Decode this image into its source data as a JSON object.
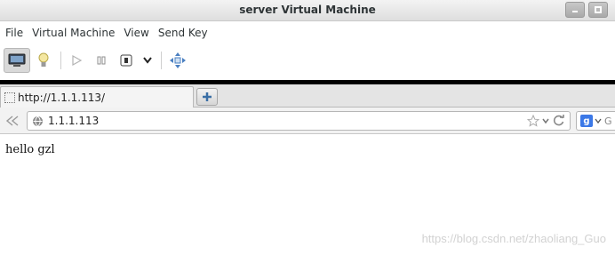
{
  "window": {
    "title": "server Virtual Machine"
  },
  "menubar": {
    "items": [
      "File",
      "Virtual Machine",
      "View",
      "Send Key"
    ]
  },
  "toolbar": {
    "buttons": [
      {
        "name": "console-icon",
        "active": true
      },
      {
        "name": "lightbulb-icon",
        "active": false
      },
      {
        "name": "play-icon",
        "active": false
      },
      {
        "name": "pause-icon",
        "active": false
      },
      {
        "name": "shutdown-icon",
        "active": false
      },
      {
        "name": "chevron-down-icon",
        "active": false
      },
      {
        "name": "fullscreen-move-icon",
        "active": false
      }
    ]
  },
  "browser": {
    "tab": {
      "title": "http://1.1.1.113/"
    },
    "urlbar": {
      "value": "1.1.1.113"
    },
    "search": {
      "placeholder": "G"
    }
  },
  "page": {
    "body_text": "hello gzl",
    "watermark": "https://blog.csdn.net/zhaoliang_Guo"
  },
  "colors": {
    "guest_border": "#000000",
    "g_logo": "#3b78e7",
    "chrome_gray": "#e4e4e4"
  }
}
